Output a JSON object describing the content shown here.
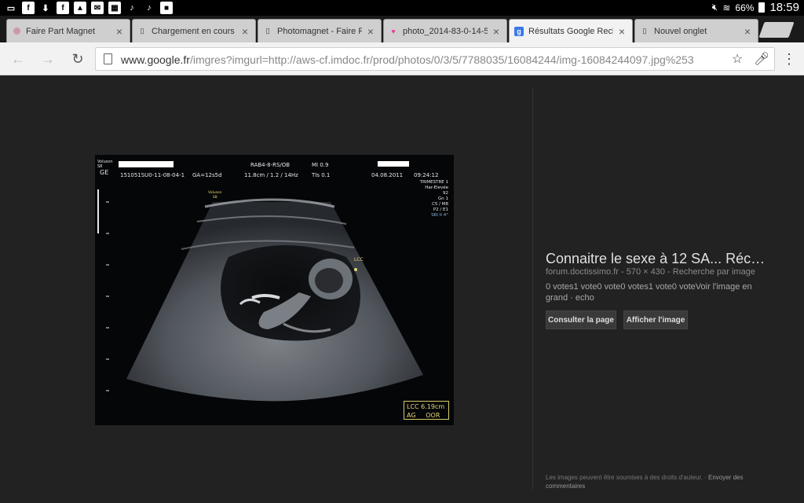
{
  "status_bar": {
    "battery": "66%",
    "time": "18:59",
    "notif_icons": [
      "cast-icon",
      "facebook-icon",
      "download-icon",
      "facebook-icon",
      "gallery-icon",
      "mail-icon",
      "app-icon",
      "music-icon",
      "music-icon",
      "briefcase-icon"
    ]
  },
  "tabs": [
    {
      "label": "Faire Part Magnet",
      "icon": "site-icon",
      "active": false
    },
    {
      "label": "Chargement en cours",
      "icon": "page-icon",
      "active": false
    },
    {
      "label": "Photomagnet - Faire P",
      "icon": "page-icon",
      "active": false
    },
    {
      "label": "photo_2014-83-0-14-5",
      "icon": "heart-icon",
      "active": false
    },
    {
      "label": "Résultats Google Rech",
      "icon": "google-icon",
      "active": true
    },
    {
      "label": "Nouvel onglet",
      "icon": "page-icon",
      "active": false
    }
  ],
  "omnibox": {
    "host": "www.google.fr",
    "path": "/imgres?imgurl=http://aws-cf.imdoc.fr/prod/photos/0/3/5/7788035/16084244/img-16084244097.jpg%253"
  },
  "scan": {
    "volume_tag": "Voluson\nS8",
    "probe": "RAB4-8-RS/OB",
    "mi": "MI 0.9",
    "patient_id": "151051SU0-11-08-04-1",
    "ga": "GA=12s5d",
    "depth": "11.8cm / 1.2 / 14Hz",
    "tis": "TIs 0.1",
    "date": "04.08.2011",
    "time": "09:24:12",
    "side_info": [
      "TRIMESTRE 1",
      "Har-Elevée",
      "92",
      "Gn    1",
      "C5 / M8",
      "P2 / E1",
      "SRI II 4°"
    ],
    "volume_mark": "Voluson\nS8",
    "lcc_label": "LCC",
    "measure_1": "LCC 6.19cm",
    "measure_2": "AG     OOR"
  },
  "info": {
    "title": "Connaitre le sexe à 12 SA... Réc…",
    "source": "forum.doctissimo.fr",
    "dimensions": "570 × 430",
    "search_by_image": "Recherche par image",
    "description": "0 votes1 vote0 vote0 votes1 vote0 voteVoir l'image en grand · echo",
    "visit_button": "Consulter la page",
    "view_button": "Afficher l'image",
    "footer_text": "Les images peuvent être soumises à des droits d'auteur.",
    "footer_link": "Envoyer des commentaires"
  }
}
